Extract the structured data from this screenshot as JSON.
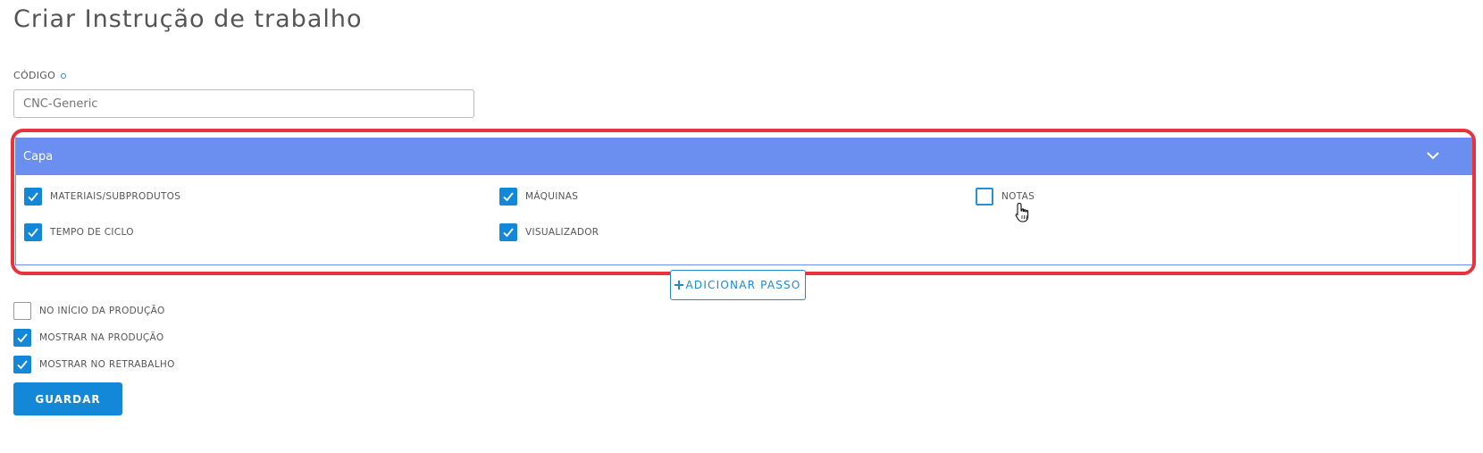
{
  "page": {
    "title": "Criar Instrução de trabalho"
  },
  "code_field": {
    "label": "CÓDIGO",
    "value": "CNC-Generic"
  },
  "capa_panel": {
    "title": "Capa",
    "options": [
      {
        "label": "MATERIAIS/SUBPRODUTOS",
        "checked": true
      },
      {
        "label": "MÁQUINAS",
        "checked": true
      },
      {
        "label": "NOTAS",
        "checked": false
      },
      {
        "label": "TEMPO DE CICLO",
        "checked": true
      },
      {
        "label": "VISUALIZADOR",
        "checked": true
      }
    ]
  },
  "add_step": {
    "icon": "plus-icon",
    "label": "ADICIONAR PASSO"
  },
  "options": [
    {
      "label": "NO INÍCIO DA PRODUÇÃO",
      "checked": false
    },
    {
      "label": "MOSTRAR NA PRODUÇÃO",
      "checked": true
    },
    {
      "label": "MOSTRAR NO RETRABALHO",
      "checked": true
    }
  ],
  "save_button": {
    "label": "GUARDAR"
  },
  "colors": {
    "accent": "#1488d8",
    "panel_header": "#6b8ff0",
    "highlight": "#e8333f"
  }
}
